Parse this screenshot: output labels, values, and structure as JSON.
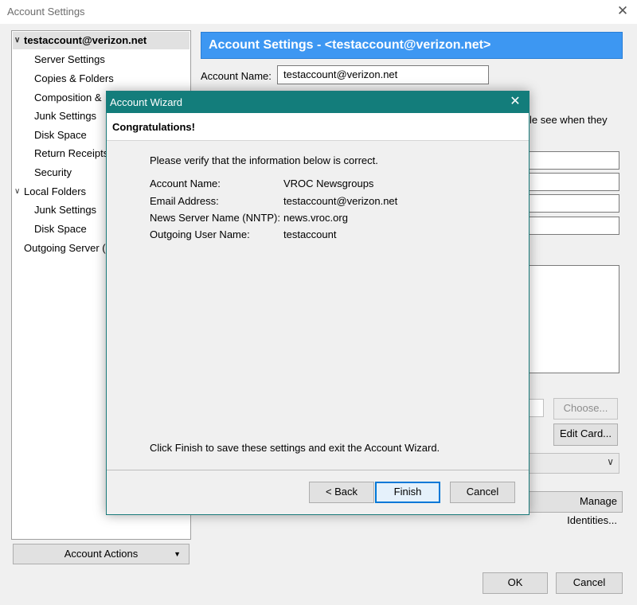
{
  "window": {
    "title": "Account Settings",
    "close_glyph": "✕"
  },
  "tree": {
    "items": [
      {
        "label": "testaccount@verizon.net",
        "selected": true,
        "expanded": true
      },
      {
        "label": "Server Settings"
      },
      {
        "label": "Copies & Folders"
      },
      {
        "label": "Composition &"
      },
      {
        "label": "Junk Settings"
      },
      {
        "label": "Disk Space"
      },
      {
        "label": "Return Receipts"
      },
      {
        "label": "Security"
      },
      {
        "label": "Local Folders",
        "expanded": true
      },
      {
        "label": "Junk Settings"
      },
      {
        "label": "Disk Space"
      },
      {
        "label": "Outgoing Server ("
      }
    ],
    "account_actions": "Account Actions"
  },
  "panel": {
    "banner": "Account Settings - <testaccount@verizon.net>",
    "account_name_label": "Account Name:",
    "account_name_value": "testaccount@verizon.net",
    "peek_text": "le see when they",
    "choose_label": "Choose...",
    "edit_card_label": "Edit Card...",
    "manage_identities_label": "Manage Identities...",
    "ok_label": "OK",
    "cancel_label": "Cancel"
  },
  "dialog": {
    "title": "Account Wizard",
    "close_glyph": "✕",
    "heading": "Congratulations!",
    "intro": "Please verify that the information below is correct.",
    "rows": [
      {
        "label": "Account Name:",
        "value": "VROC Newsgroups"
      },
      {
        "label": "Email Address:",
        "value": "testaccount@verizon.net"
      },
      {
        "label": "News Server Name (NNTP):",
        "value": "news.vroc.org"
      },
      {
        "label": "Outgoing User Name:",
        "value": "testaccount"
      }
    ],
    "footer_text": "Click Finish to save these settings and exit the Account Wizard.",
    "back_label": "< Back",
    "finish_label": "Finish",
    "cancel_label": "Cancel"
  },
  "colors": {
    "banner": "#3d97f2",
    "dialog_titlebar": "#137d7b",
    "default_button_border": "#0078d7"
  }
}
